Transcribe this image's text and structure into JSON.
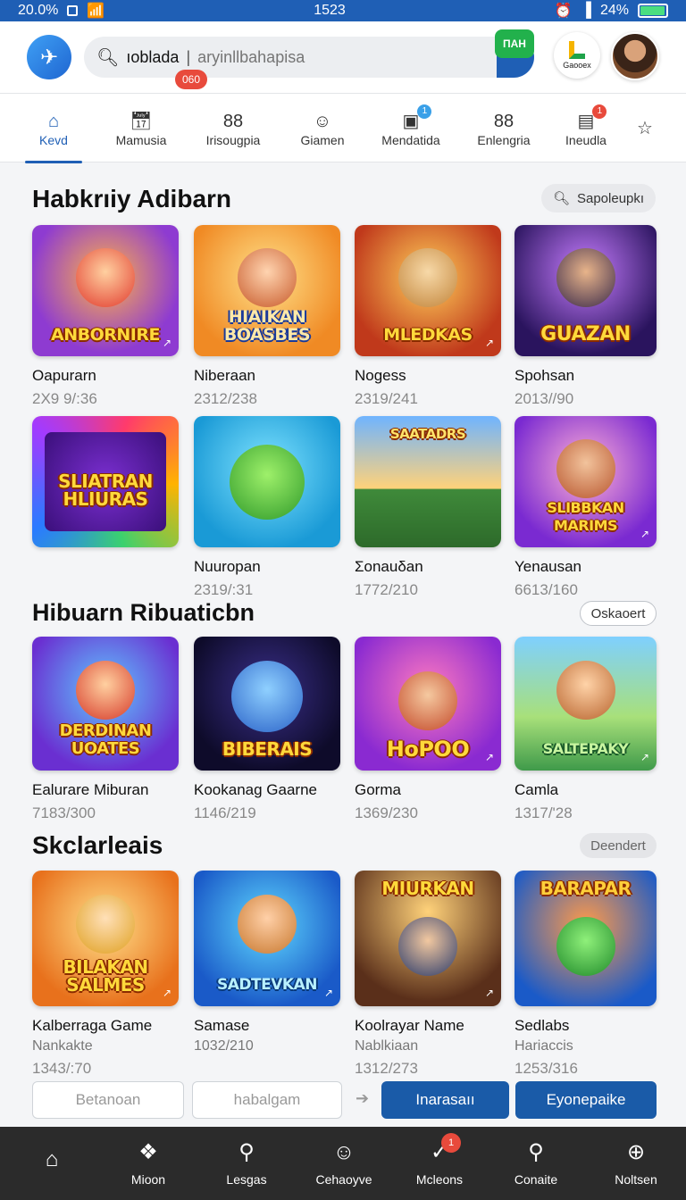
{
  "status_bar": {
    "left_text": "20.0%",
    "time": "1523",
    "battery_text": "24%",
    "battery_level": 0.9
  },
  "header": {
    "search_value": "ıoblada",
    "search_placeholder": "aryinllbahapisa",
    "search_go_label": "ПАН",
    "search_badge": "060",
    "brand_label": "Gaooex"
  },
  "tabs": [
    {
      "label": "Kevd",
      "icon": "home-icon",
      "active": true
    },
    {
      "label": "Mamusia",
      "icon": "calendar-icon"
    },
    {
      "label": "Irisougpia",
      "icon": "grid-icon"
    },
    {
      "label": "Giamen",
      "icon": "controller-icon"
    },
    {
      "label": "Mendatida",
      "icon": "bag-icon",
      "badge": "1",
      "badge_color": "#3aa0e8"
    },
    {
      "label": "Enlengria",
      "icon": "grid-icon"
    },
    {
      "label": "Ineudla",
      "icon": "ticket-icon",
      "badge": "1",
      "badge_color": "#e84a3c"
    },
    {
      "label": "",
      "icon": "star-outline-icon"
    }
  ],
  "sections": {
    "s1": {
      "title": "Habkrıiy Adibarn",
      "action": "Sapoleupkı"
    },
    "s2": {
      "title": "Hibuarn Ribuaticbn",
      "action": "Oskaoert"
    },
    "s3": {
      "title": "Skclarleais",
      "action": "Deendert"
    }
  },
  "cards_row1": [
    {
      "name": "Oapurarn",
      "meta": "2Х9 9/:36",
      "word": "ANBORNIRE"
    },
    {
      "name": "Niberaan",
      "meta": "2312/238",
      "word": "HIAIKAN BOASBES"
    },
    {
      "name": "Nogess",
      "meta": "2319/241",
      "word": "MLEDKAS"
    },
    {
      "name": "Spohsan",
      "meta": "2013//90",
      "word": "GUAZAN"
    }
  ],
  "cards_row2": [
    {
      "name": "",
      "meta": "",
      "word": "SLIATRAN HLIURAS"
    },
    {
      "name": "Nuuropan",
      "meta": "2319/:31",
      "word": ""
    },
    {
      "name": "Σonauδan",
      "meta": "1772/210",
      "word": "SAATADRS"
    },
    {
      "name": "Yenausan",
      "meta": "6613/160",
      "word": "SLIBBKAN MARIMS"
    }
  ],
  "cards_row3": [
    {
      "name": "Ealurare Miburan",
      "meta": "7183/300",
      "word": "DERDINAN UOATES"
    },
    {
      "name": "Kookanag Gaarne",
      "meta": "1146/219",
      "word": "BIBERAIS"
    },
    {
      "name": "Gorma",
      "meta": "1369/230",
      "word": "HoPOO"
    },
    {
      "name": "Camla",
      "meta": "1317/'28",
      "word": "SALTEPAKY"
    }
  ],
  "cards_row4": [
    {
      "name": "Kalberraga Game",
      "sub": "Nankakte",
      "meta": "1343/:70",
      "word": "BILAKAN SALMES"
    },
    {
      "name": "Samase",
      "sub": "1032/210",
      "meta": "",
      "word": "SADTEVKAN"
    },
    {
      "name": "Koolrayar Name",
      "sub": "Nablkiaan",
      "meta": "1312/273",
      "word": "MIURKAN"
    },
    {
      "name": "Sedlabs",
      "sub": "Hariaccis",
      "meta": "1253/316",
      "word": "BARAPAR"
    }
  ],
  "actions": {
    "btn1": "Betanoan",
    "btn2": "habalgam",
    "btn3": "Inarasaıı",
    "btn4": "Eyonepaike"
  },
  "bottom_nav": [
    {
      "label": "",
      "icon": "home-icon"
    },
    {
      "label": "Mioon",
      "icon": "puzzle-icon"
    },
    {
      "label": "Lesgas",
      "icon": "search-icon"
    },
    {
      "label": "Cehaoyve",
      "icon": "smiley-icon"
    },
    {
      "label": "Mcleons",
      "icon": "checkmark-icon",
      "badge": "1"
    },
    {
      "label": "Conaite",
      "icon": "search-icon"
    },
    {
      "label": "Noltsen",
      "icon": "menu-circle-icon"
    }
  ]
}
